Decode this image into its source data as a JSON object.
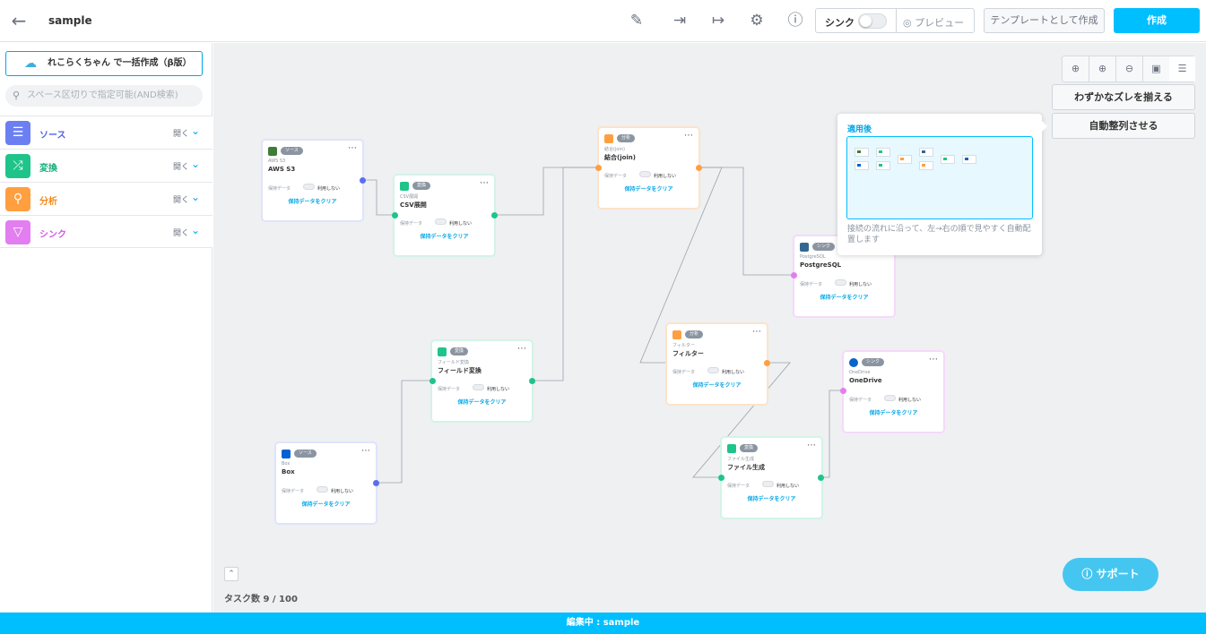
{
  "header": {
    "back_icon": "arrow-left-icon",
    "title": "sample",
    "icons": [
      "pencil-icon",
      "import-icon",
      "export-icon",
      "gear-icon",
      "help-icon"
    ],
    "sync_label": "シンク",
    "preview_label": "プレビュー",
    "template_button": "テンプレートとして作成",
    "create_button": "作成"
  },
  "sidebar": {
    "bulk_button": "れこらくちゃん で一括作成（β版）",
    "search_placeholder": "スペース区切りで指定可能(AND検索)",
    "categories": [
      {
        "label": "ソース",
        "open": "開く",
        "color": "#6c7ff2",
        "icon": "database-icon"
      },
      {
        "label": "変換",
        "open": "開く",
        "color": "#1fc48a",
        "icon": "shuffle-icon"
      },
      {
        "label": "分析",
        "open": "開く",
        "color": "#ff9f40",
        "icon": "analysis-icon"
      },
      {
        "label": "シンク",
        "open": "開く",
        "color": "#e27ef0",
        "icon": "sink-icon"
      }
    ]
  },
  "canvas": {
    "align_button": "わずかなズレを揃える",
    "auto_arrange_button": "自動整列させる",
    "tooltip_title": "適用後",
    "tooltip_desc": "接続の流れに沿って、左→右の順で見やすく自動配置します",
    "task_count": "タスク数 9 / 100",
    "support_button": "サポート"
  },
  "nodes": [
    {
      "id": "aws",
      "badge": "ソース",
      "sub": "AWS S3",
      "name": "AWS S3",
      "keep": "保持データ",
      "nouse": "利用しない",
      "clear": "保持データをクリア"
    },
    {
      "id": "csv",
      "badge": "変換",
      "sub": "CSV展開",
      "name": "CSV展開",
      "keep": "保持データ",
      "nouse": "利用しない",
      "clear": "保持データをクリア"
    },
    {
      "id": "join",
      "badge": "分析",
      "sub": "結合(join)",
      "name": "結合(join)",
      "keep": "保持データ",
      "nouse": "利用しない",
      "clear": "保持データをクリア"
    },
    {
      "id": "pg",
      "badge": "シンク",
      "sub": "PostgreSQL",
      "name": "PostgreSQL",
      "keep": "保持データ",
      "nouse": "利用しない",
      "clear": "保持データをクリア"
    },
    {
      "id": "field",
      "badge": "変換",
      "sub": "フィールド変換",
      "name": "フィールド変換",
      "keep": "保持データ",
      "nouse": "利用しない",
      "clear": "保持データをクリア"
    },
    {
      "id": "filter",
      "badge": "分析",
      "sub": "フィルター",
      "name": "フィルター",
      "keep": "保持データ",
      "nouse": "利用しない",
      "clear": "保持データをクリア"
    },
    {
      "id": "onedrive",
      "badge": "シンク",
      "sub": "OneDrive",
      "name": "OneDrive",
      "keep": "保持データ",
      "nouse": "利用しない",
      "clear": "保持データをクリア"
    },
    {
      "id": "box",
      "badge": "ソース",
      "sub": "Box",
      "name": "Box",
      "keep": "保持データ",
      "nouse": "利用しない",
      "clear": "保持データをクリア"
    },
    {
      "id": "file",
      "badge": "変換",
      "sub": "ファイル生成",
      "name": "ファイル生成",
      "keep": "保持データ",
      "nouse": "利用しない",
      "clear": "保持データをクリア"
    }
  ],
  "footer": {
    "status": "編集中 : sample"
  }
}
